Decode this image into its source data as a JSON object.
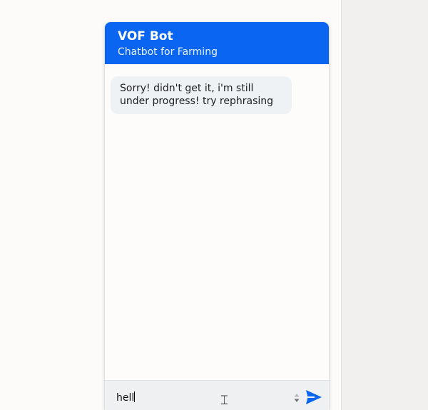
{
  "chat": {
    "title": "VOF Bot",
    "subtitle": "Chatbot for Farming",
    "messages": [
      {
        "sender": "bot",
        "text": "Sorry! didn't get it, i'm still under progress! try rephrasing"
      }
    ]
  },
  "composer": {
    "value": "hell",
    "send_icon": "send-icon",
    "stepper_icon": "number-stepper-icon"
  },
  "colors": {
    "header": "#0a66f0",
    "send": "#0a66f0",
    "bubble": "#eff2f5",
    "page": "#fcfbfa"
  }
}
